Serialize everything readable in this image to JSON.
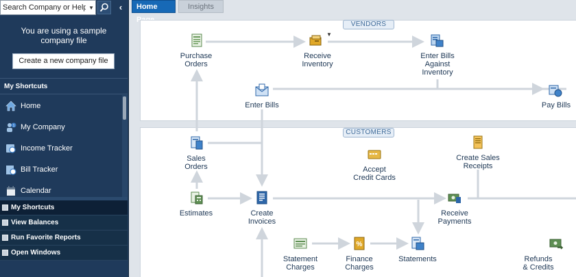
{
  "search": {
    "placeholder": "Search Company or Help"
  },
  "sidebar": {
    "sample_msg": "You are using a sample\ncompany file",
    "create_button": "Create a new company file",
    "shortcuts_header": "My Shortcuts",
    "shortcuts": [
      {
        "label": "Home",
        "icon": "house-icon"
      },
      {
        "label": "My Company",
        "icon": "company-icon"
      },
      {
        "label": "Income Tracker",
        "icon": "income-tracker-icon"
      },
      {
        "label": "Bill Tracker",
        "icon": "bill-tracker-icon"
      },
      {
        "label": "Calendar",
        "icon": "calendar-icon"
      }
    ],
    "bottom_nav": [
      {
        "label": "My Shortcuts"
      },
      {
        "label": "View Balances"
      },
      {
        "label": "Run Favorite Reports"
      },
      {
        "label": "Open Windows"
      }
    ]
  },
  "tabs": {
    "home": "Home Page",
    "insights": "Insights"
  },
  "vendors": {
    "tag": "VENDORS",
    "purchase_orders": "Purchase\nOrders",
    "receive_inventory": "Receive\nInventory",
    "enter_bills_against": "Enter Bills\nAgainst\nInventory",
    "enter_bills": "Enter Bills",
    "pay_bills": "Pay Bills"
  },
  "customers": {
    "tag": "CUSTOMERS",
    "sales_orders": "Sales\nOrders",
    "accept_cc": "Accept\nCredit Cards",
    "sales_receipts": "Create Sales\nReceipts",
    "estimates": "Estimates",
    "create_invoices": "Create\nInvoices",
    "receive_payments": "Receive\nPayments",
    "statement_charges": "Statement\nCharges",
    "finance_charges": "Finance\nCharges",
    "statements": "Statements",
    "refunds": "Refunds\n& Credits"
  },
  "colors": {
    "sidebar_bg": "#1f3a5b",
    "tab_active": "#1769b6",
    "flow_arrow": "#cfd5dc",
    "label_text": "#1b3553"
  }
}
